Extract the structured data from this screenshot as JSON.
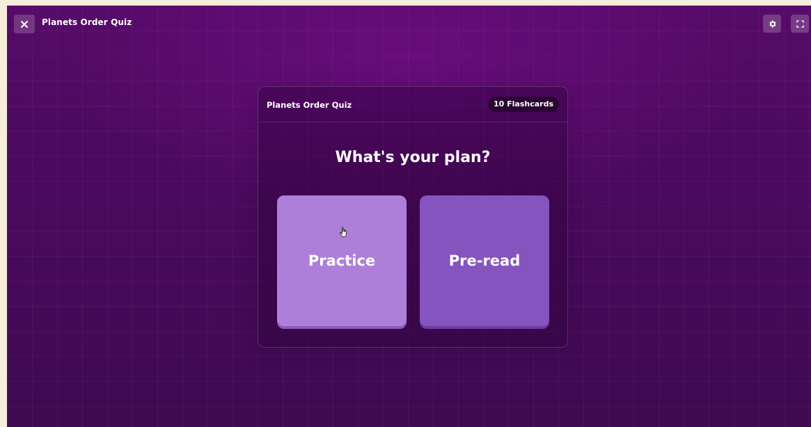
{
  "app": {
    "title": "Planets Order Quiz"
  },
  "toolbar": {
    "close_icon": "close-icon",
    "settings_icon": "gear-icon",
    "fullscreen_icon": "fullscreen-icon"
  },
  "deck": {
    "title": "Planets Order Quiz",
    "count_label": "10 Flashcards"
  },
  "plan": {
    "heading": "What's your plan?",
    "options": [
      {
        "label": "Practice",
        "color": "#ae7fd8"
      },
      {
        "label": "Pre-read",
        "color": "#8654be"
      }
    ]
  },
  "colors": {
    "background": "#4a0a5d",
    "badge": "#2a0533"
  }
}
